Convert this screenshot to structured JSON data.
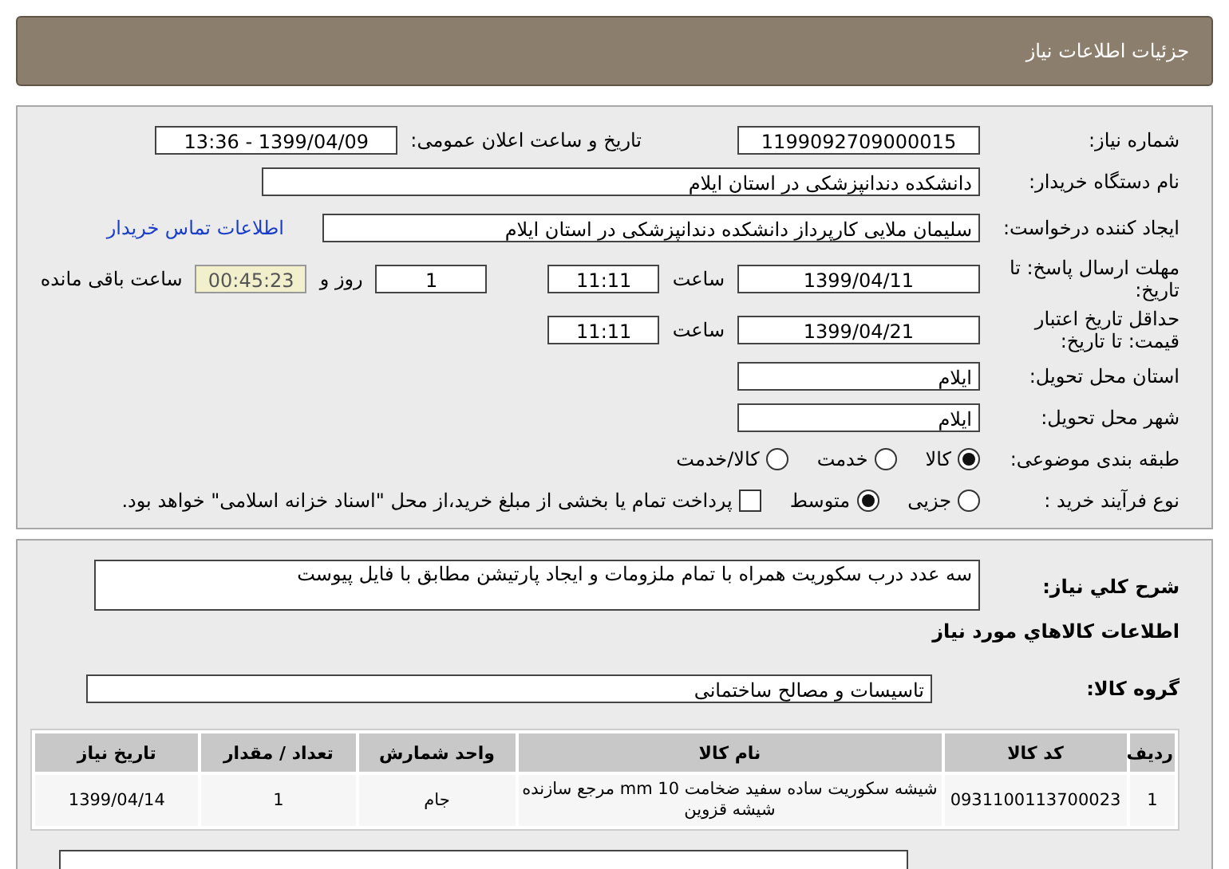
{
  "header": {
    "title": "جزئیات اطلاعات نیاز"
  },
  "need_number": {
    "label": "شماره نیاز:",
    "value": "1199092709000015"
  },
  "announce": {
    "label": "تاریخ و ساعت اعلان عمومی:",
    "value": "1399/04/09 - 13:36"
  },
  "buyer": {
    "label": "نام دستگاه خریدار:",
    "value": "دانشکده دندانپزشکی در استان ایلام"
  },
  "requester": {
    "label": "ایجاد کننده درخواست:",
    "value": "سلیمان  ملایی کارپرداز دانشکده دندانپزشکی در استان ایلام",
    "link": "اطلاعات تماس خریدار"
  },
  "reply_deadline": {
    "label": "مهلت ارسال پاسخ: تا تاریخ:",
    "date": "1399/04/11",
    "time_label": "ساعت",
    "time": "11:11",
    "days": "1",
    "days_label": "روز و",
    "remaining": "00:45:23",
    "remaining_label": "ساعت باقی مانده"
  },
  "validity": {
    "label": "حداقل تاریخ اعتبار قیمت: تا تاریخ:",
    "date": "1399/04/21",
    "time_label": "ساعت",
    "time": "11:11"
  },
  "province": {
    "label": "استان محل تحویل:",
    "value": "ایلام"
  },
  "city": {
    "label": "شهر محل تحویل:",
    "value": "ایلام"
  },
  "category": {
    "label": "طبقه بندی موضوعی:",
    "options": [
      {
        "label": "کالا",
        "selected": true
      },
      {
        "label": "خدمت",
        "selected": false
      },
      {
        "label": "کالا/خدمت",
        "selected": false
      }
    ]
  },
  "process": {
    "label": "نوع فرآیند خرید :",
    "options": [
      {
        "label": "جزیی",
        "selected": false
      },
      {
        "label": "متوسط",
        "selected": true
      }
    ],
    "checkbox": {
      "label": "پرداخت تمام یا بخشی از مبلغ خرید،از محل \"اسناد خزانه اسلامی\" خواهد بود.",
      "checked": false
    }
  },
  "description": {
    "label": "شرح کلي نياز:",
    "value": "سه عدد درب سکوریت همراه با تمام ملزومات و ایجاد پارتیشن مطابق با فایل پیوست"
  },
  "goods_title": "اطلاعات کالاهاي مورد نياز",
  "group": {
    "label": "گروه کالا:",
    "value": "تاسیسات و مصالح ساختمانی"
  },
  "table": {
    "columns": [
      "ردیف",
      "کد کالا",
      "نام کالا",
      "واحد شمارش",
      "تعداد / مقدار",
      "تاریخ نیاز"
    ],
    "rows": [
      [
        "1",
        "0931100113700023",
        "شیشه سکوریت ساده سفید ضخامت 10 mm مرجع سازنده شیشه قزوین",
        "جام",
        "1",
        "1399/04/14"
      ]
    ]
  }
}
